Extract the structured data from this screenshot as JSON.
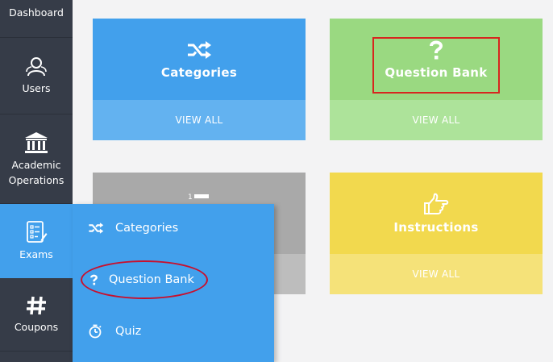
{
  "sidebar": {
    "items": [
      {
        "label": "Dashboard",
        "icon": "dashboard-icon"
      },
      {
        "label": "Users",
        "icon": "users-icon"
      },
      {
        "label": "Academic\nOperations",
        "icon": "academic-building-icon"
      },
      {
        "label": "Exams",
        "icon": "exam-clipboard-icon"
      },
      {
        "label": "Coupons",
        "icon": "hashtag-icon"
      }
    ]
  },
  "cards": [
    {
      "title": "Categories",
      "action": "VIEW ALL",
      "icon": "shuffle-icon",
      "color": "#42a0ec"
    },
    {
      "title": "Question Bank",
      "action": "VIEW ALL",
      "icon": "question-mark-icon",
      "color": "#9ad981"
    },
    {
      "title": "",
      "action": "",
      "icon": "ordered-list-icon",
      "color": "#a9a9a9"
    },
    {
      "title": "Instructions",
      "action": "VIEW ALL",
      "icon": "pointing-hand-icon",
      "color": "#f2d94e"
    }
  ],
  "submenu": {
    "items": [
      {
        "label": "Categories",
        "icon": "shuffle-icon"
      },
      {
        "label": "Question Bank",
        "icon": "question-mark-icon"
      },
      {
        "label": "Quiz",
        "icon": "timer-icon"
      }
    ]
  },
  "annotations": {
    "highlight_color": "#d7261e"
  }
}
